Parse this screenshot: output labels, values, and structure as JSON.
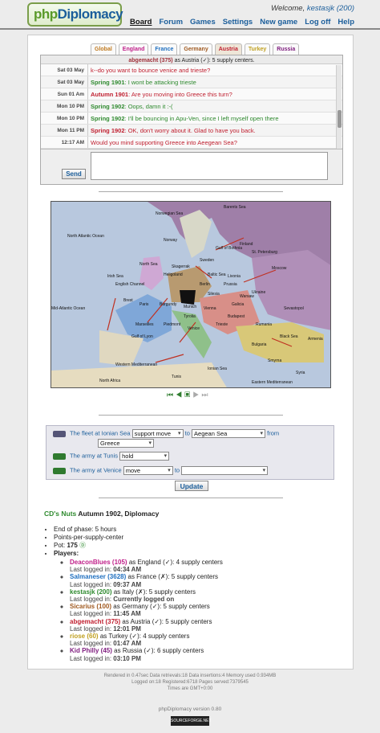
{
  "header": {
    "logo_a": "php",
    "logo_b": "Diplomacy",
    "welcome_text": "Welcome,",
    "username": "kestasjk (200)",
    "nav": [
      "Board",
      "Forum",
      "Games",
      "Settings",
      "New game",
      "Log off",
      "Help"
    ]
  },
  "tabs": [
    {
      "label": "Global",
      "color": "#c07a20"
    },
    {
      "label": "England",
      "color": "#c0208a"
    },
    {
      "label": "France",
      "color": "#2070c0"
    },
    {
      "label": "Germany",
      "color": "#a05a20"
    },
    {
      "label": "Austria",
      "color": "#c02030"
    },
    {
      "label": "Turkey",
      "color": "#c0a020"
    },
    {
      "label": "Russia",
      "color": "#802080"
    }
  ],
  "chat": {
    "header_who": "abgemacht (375)",
    "header_rest": " as Austria (✓): 5 supply centers.",
    "messages": [
      {
        "time": "Sat 03 May",
        "season": "",
        "text": "k--do you want to bounce venice and trieste?",
        "color": "#c02030"
      },
      {
        "time": "Sat 03 May",
        "season": "Spring 1901",
        "text": ": I wont be attacking trieste",
        "color": "#2f8a2f"
      },
      {
        "time": "Sun 01 Am",
        "season": "Autumn 1901",
        "text": ": Are you moving into Greece this turn?",
        "color": "#c02030"
      },
      {
        "time": "Mon 10 PM",
        "season": "Spring 1902",
        "text": ": Oops, damn it :-(",
        "color": "#2f8a2f"
      },
      {
        "time": "Mon 10 PM",
        "season": "Spring 1902",
        "text": ": I'll be bouncing in Apu-Ven, since I left myself open there",
        "color": "#2f8a2f"
      },
      {
        "time": "Mon 11 PM",
        "season": "Spring 1902",
        "text": ": OK, don't worry about it. Glad to have you back.",
        "color": "#c02030"
      },
      {
        "time": "12:17 AM",
        "season": "",
        "text": "Would you mind supporting Greece into Aeegean Sea?",
        "color": "#c02030"
      }
    ],
    "first_season": "Spring 1901",
    "send_label": "Send"
  },
  "map_labels": [
    "Norwegian Sea",
    "Barents Sea",
    "North Atlantic Ocean",
    "Norway",
    "Finland",
    "St. Petersburg",
    "Gulf of Bothnia",
    "Skagerrak",
    "North Sea",
    "Sweden",
    "Heligoland",
    "Baltic Sea",
    "Livonia",
    "Moscow",
    "Irish Sea",
    "English Channel",
    "Ukraine",
    "Berlin",
    "Prussia",
    "Warsaw",
    "Silesia",
    "Galicia",
    "Munich",
    "Brest",
    "Paris",
    "Burgundy",
    "Mid-Atlantic Ocean",
    "Vienna",
    "Budapest",
    "Sevastopol",
    "Rumania",
    "Tyrolia",
    "Trieste",
    "Gulf of Lyon",
    "Marseilles",
    "Piedmont",
    "Venice",
    "Black Sea",
    "Bulgaria",
    "Armenia",
    "Smyrna",
    "Western Mediterranean",
    "Ionian Sea",
    "Syria",
    "Tunis",
    "North Africa",
    "Eastern Mediterranean"
  ],
  "orders": [
    {
      "unit": "The fleet at Ionian Sea",
      "order": "support move",
      "to_word": "to",
      "target": "Aegean Sea",
      "from_word": "from",
      "from": "Greece"
    },
    {
      "unit": "The army at Tunis",
      "order": "hold"
    },
    {
      "unit": "The army at Venice",
      "order": "move",
      "to_word": "to",
      "target": ""
    }
  ],
  "update_label": "Update",
  "game": {
    "name": "CD's Nuts",
    "status": "Autumn 1902, Diplomacy",
    "phase_end": "End of phase: 5 hours",
    "scoring": "Points-per-supply-center",
    "pot_label": "Pot:",
    "pot": "175",
    "players_label": "Players:",
    "players": [
      {
        "name": "DeaconBlues (105)",
        "as": "as England (✓):",
        "sc": "4 supply centers",
        "color": "#c0208a",
        "login": "Last logged in:",
        "time": "04:34 AM"
      },
      {
        "name": "Salmaneser (3628)",
        "as": "as France (✗):",
        "sc": "5 supply centers",
        "color": "#2070c0",
        "login": "Last logged in:",
        "time": "09:37 AM"
      },
      {
        "name": "kestasjk (200)",
        "as": "as Italy (✗):",
        "sc": "5 supply centers",
        "color": "#2f8a2f",
        "login": "Last logged in:",
        "time": "Currently logged on"
      },
      {
        "name": "Sicarius (100)",
        "as": "as Germany (✓):",
        "sc": "5 supply centers",
        "color": "#a05a20",
        "login": "Last logged in:",
        "time": "11:45 AM"
      },
      {
        "name": "abgemacht (375)",
        "as": "as Austria (✓):",
        "sc": "5 supply centers",
        "color": "#c02030",
        "login": "Last logged in:",
        "time": "12:01 PM"
      },
      {
        "name": "riose (60)",
        "as": "as Turkey (✓):",
        "sc": "4 supply centers",
        "color": "#c0a020",
        "login": "Last logged in:",
        "time": "01:47 AM"
      },
      {
        "name": "Kid Philly (45)",
        "as": "as Russia (✓):",
        "sc": "6 supply centers",
        "color": "#802080",
        "login": "Last logged in:",
        "time": "03:10 PM"
      }
    ]
  },
  "footer": {
    "line1": "Rendered in 0.47sec Data retrievals:18 Data insertions:4 Memory used 0.934MB",
    "line2": "Logged on:18 Registered:6718 Pages served:7379545",
    "line3": "Times are GMT+0:00",
    "version": "phpDiplomacy version 0.80",
    "sf": "SOURCEFORGE.NET"
  }
}
